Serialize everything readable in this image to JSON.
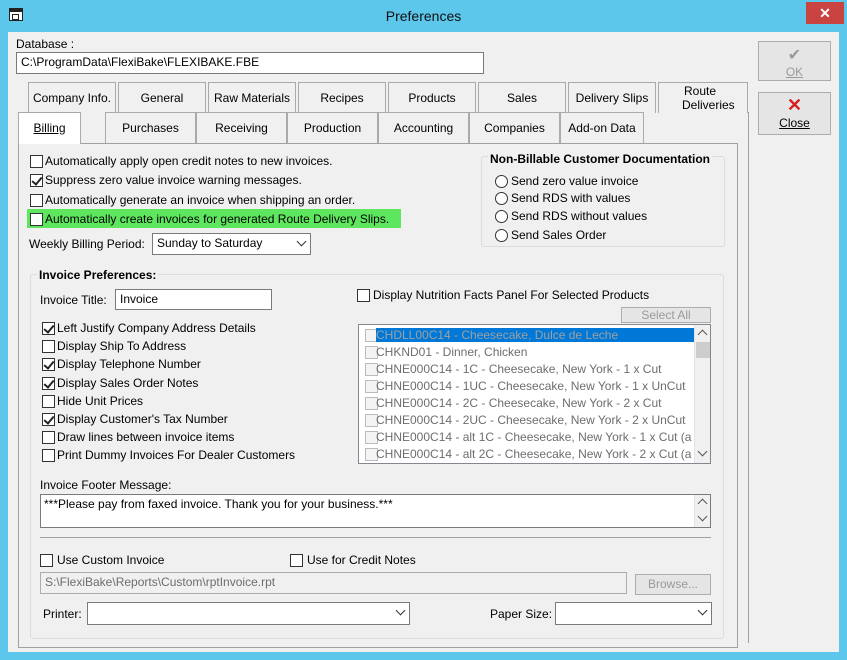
{
  "window": {
    "title": "Preferences",
    "close_glyph": "✕"
  },
  "database": {
    "label": "Database :",
    "path": "C:\\ProgramData\\FlexiBake\\FLEXIBAKE.FBE"
  },
  "buttons": {
    "ok": "OK",
    "close": "Close"
  },
  "tabs_row1": [
    "Company Info.",
    "General",
    "Raw Materials",
    "Recipes",
    "Products",
    "Sales",
    "Delivery Slips",
    "Route Deliveries"
  ],
  "tabs_row2": [
    "Billing",
    "Purchases",
    "Receiving",
    "Production",
    "Accounting",
    "Companies",
    "Add-on Data"
  ],
  "billing": {
    "options": [
      {
        "label": "Automatically apply open credit notes to new invoices.",
        "checked": false
      },
      {
        "label": "Suppress zero value invoice warning messages.",
        "checked": true
      },
      {
        "label": "Automatically generate an invoice when shipping an order.",
        "checked": false
      },
      {
        "label": "Automatically create invoices for generated Route Delivery Slips.",
        "checked": false
      }
    ],
    "weekly_period_label": "Weekly Billing Period:",
    "weekly_period_value": "Sunday to Saturday"
  },
  "nonbillable": {
    "title": "Non-Billable Customer Documentation",
    "options": [
      "Send zero value invoice",
      "Send RDS with values",
      "Send RDS without values",
      "Send Sales Order"
    ]
  },
  "invoice_prefs": {
    "title": "Invoice Preferences:",
    "invoice_title_label": "Invoice Title:",
    "invoice_title_value": "Invoice",
    "options": [
      {
        "label": "Left Justify Company Address Details",
        "checked": true
      },
      {
        "label": "Display Ship To Address",
        "checked": false
      },
      {
        "label": "Display Telephone Number",
        "checked": true
      },
      {
        "label": "Display Sales Order Notes",
        "checked": true
      },
      {
        "label": "Hide Unit Prices",
        "checked": false
      },
      {
        "label": "Display Customer's Tax Number",
        "checked": true
      },
      {
        "label": "Draw lines between invoice items",
        "checked": false
      },
      {
        "label": "Print Dummy Invoices For Dealer Customers",
        "checked": false
      }
    ],
    "nutrition_label": "Display Nutrition Facts Panel For Selected Products",
    "select_all": "Select All",
    "products": [
      "CHDLL00C14 - Cheesecake, Dulce de Leche",
      "CHKND01 - Dinner, Chicken",
      "CHNE000C14 - 1C - Cheesecake, New York - 1 x Cut",
      "CHNE000C14 - 1UC - Cheesecake, New York - 1 x UnCut",
      "CHNE000C14 - 2C - Cheesecake, New York - 2 x Cut",
      "CHNE000C14 - 2UC - Cheesecake, New York - 2 x UnCut",
      "CHNE000C14 - alt 1C - Cheesecake, New York - 1 x Cut (a",
      "CHNE000C14 - alt 2C - Cheesecake, New York - 2 x Cut (a"
    ],
    "footer_label": "Invoice Footer Message:",
    "footer_value": "***Please pay from faxed invoice. Thank you for your business.***",
    "custom_invoice_label": "Use Custom Invoice",
    "credit_notes_label": "Use for Credit Notes",
    "custom_path": "S:\\FlexiBake\\Reports\\Custom\\rptInvoice.rpt",
    "browse": "Browse...",
    "printer_label": "Printer:",
    "printer_value": "",
    "paper_size_label": "Paper Size:",
    "paper_size_value": ""
  },
  "colors": {
    "titlebar": "#5cc7ea",
    "close": "#c94340",
    "highlight": "#5ee65e",
    "selection": "#0078d7"
  }
}
